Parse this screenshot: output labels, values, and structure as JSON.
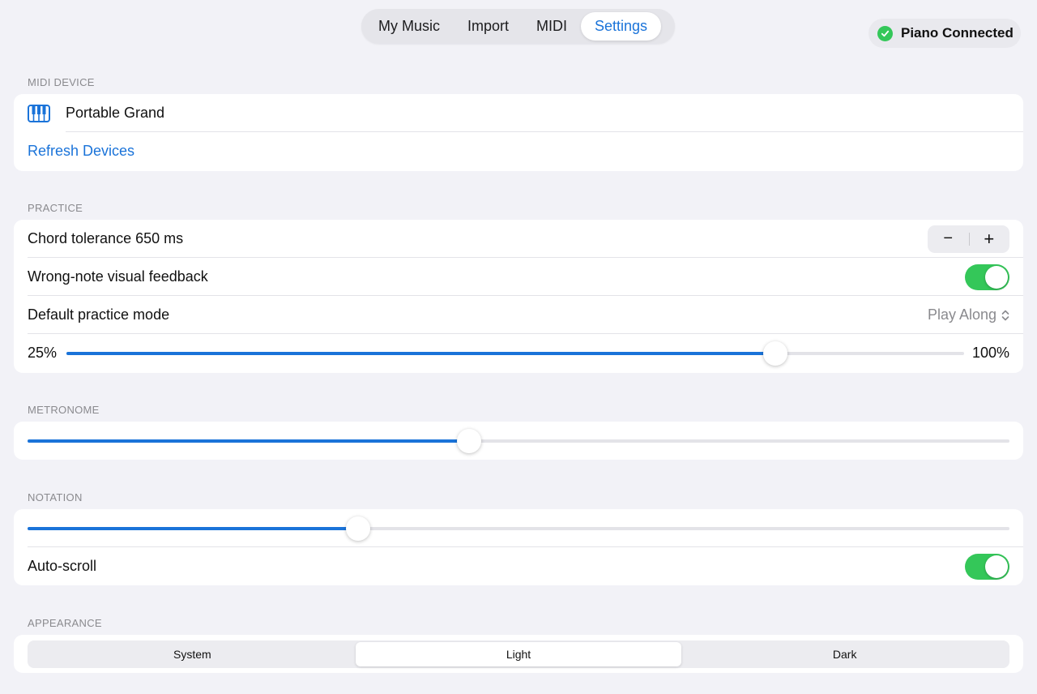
{
  "tabs": [
    {
      "label": "My Music",
      "active": false
    },
    {
      "label": "Import",
      "active": false
    },
    {
      "label": "MIDI",
      "active": false
    },
    {
      "label": "Settings",
      "active": true
    }
  ],
  "status": {
    "label": "Piano Connected",
    "icon": "check-circle-icon",
    "color": "#34c759"
  },
  "midi_device": {
    "section_label": "MIDI DEVICE",
    "device_name": "Portable Grand",
    "device_icon": "piano-keys-icon",
    "refresh_label": "Refresh Devices"
  },
  "practice": {
    "section_label": "PRACTICE",
    "chord_tolerance_label": "Chord tolerance 650 ms",
    "stepper_minus": "−",
    "stepper_plus": "+",
    "wrong_note_label": "Wrong-note visual feedback",
    "wrong_note_enabled": true,
    "default_mode_label": "Default practice mode",
    "default_mode_value": "Play Along",
    "speed_min_label": "25%",
    "speed_max_label": "100%",
    "speed_value": 0.79
  },
  "metronome": {
    "section_label": "METRONOME",
    "value": 0.45
  },
  "notation": {
    "section_label": "NOTATION",
    "value": 0.337,
    "auto_scroll_label": "Auto-scroll",
    "auto_scroll_enabled": true
  },
  "appearance": {
    "section_label": "APPEARANCE",
    "options": [
      {
        "label": "System",
        "active": false
      },
      {
        "label": "Light",
        "active": true
      },
      {
        "label": "Dark",
        "active": false
      }
    ]
  },
  "colors": {
    "accent": "#1a73d9",
    "toggle_on": "#34c759",
    "background": "#f2f2f7"
  }
}
